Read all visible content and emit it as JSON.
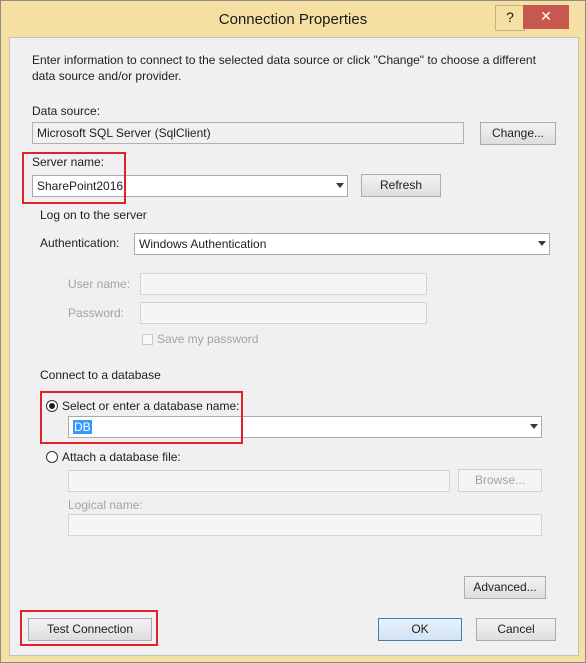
{
  "window": {
    "title": "Connection Properties",
    "help_label": "?",
    "close_label": "✕"
  },
  "intro": "Enter information to connect to the selected data source or click \"Change\" to choose a different data source and/or provider.",
  "data_source": {
    "label": "Data source:",
    "value": "Microsoft SQL Server (SqlClient)",
    "change_button": "Change..."
  },
  "server": {
    "label": "Server name:",
    "value": "SharePoint2016",
    "refresh_button": "Refresh"
  },
  "logon": {
    "heading": "Log on to the server",
    "auth_label": "Authentication:",
    "auth_value": "Windows Authentication",
    "user_label": "User name:",
    "user_value": "",
    "password_label": "Password:",
    "password_value": "",
    "save_password_label": "Save my password"
  },
  "database": {
    "heading": "Connect to a database",
    "select_label": "Select or enter a database name:",
    "select_value": "DB",
    "attach_label": "Attach a database file:",
    "attach_value": "",
    "browse_button": "Browse...",
    "logical_label": "Logical name:",
    "logical_value": ""
  },
  "buttons": {
    "advanced": "Advanced...",
    "test": "Test Connection",
    "ok": "OK",
    "cancel": "Cancel"
  },
  "colors": {
    "titlebar": "#f5dfa3",
    "close": "#c7584f",
    "highlight": "#e2202a",
    "selection": "#3399ff"
  }
}
